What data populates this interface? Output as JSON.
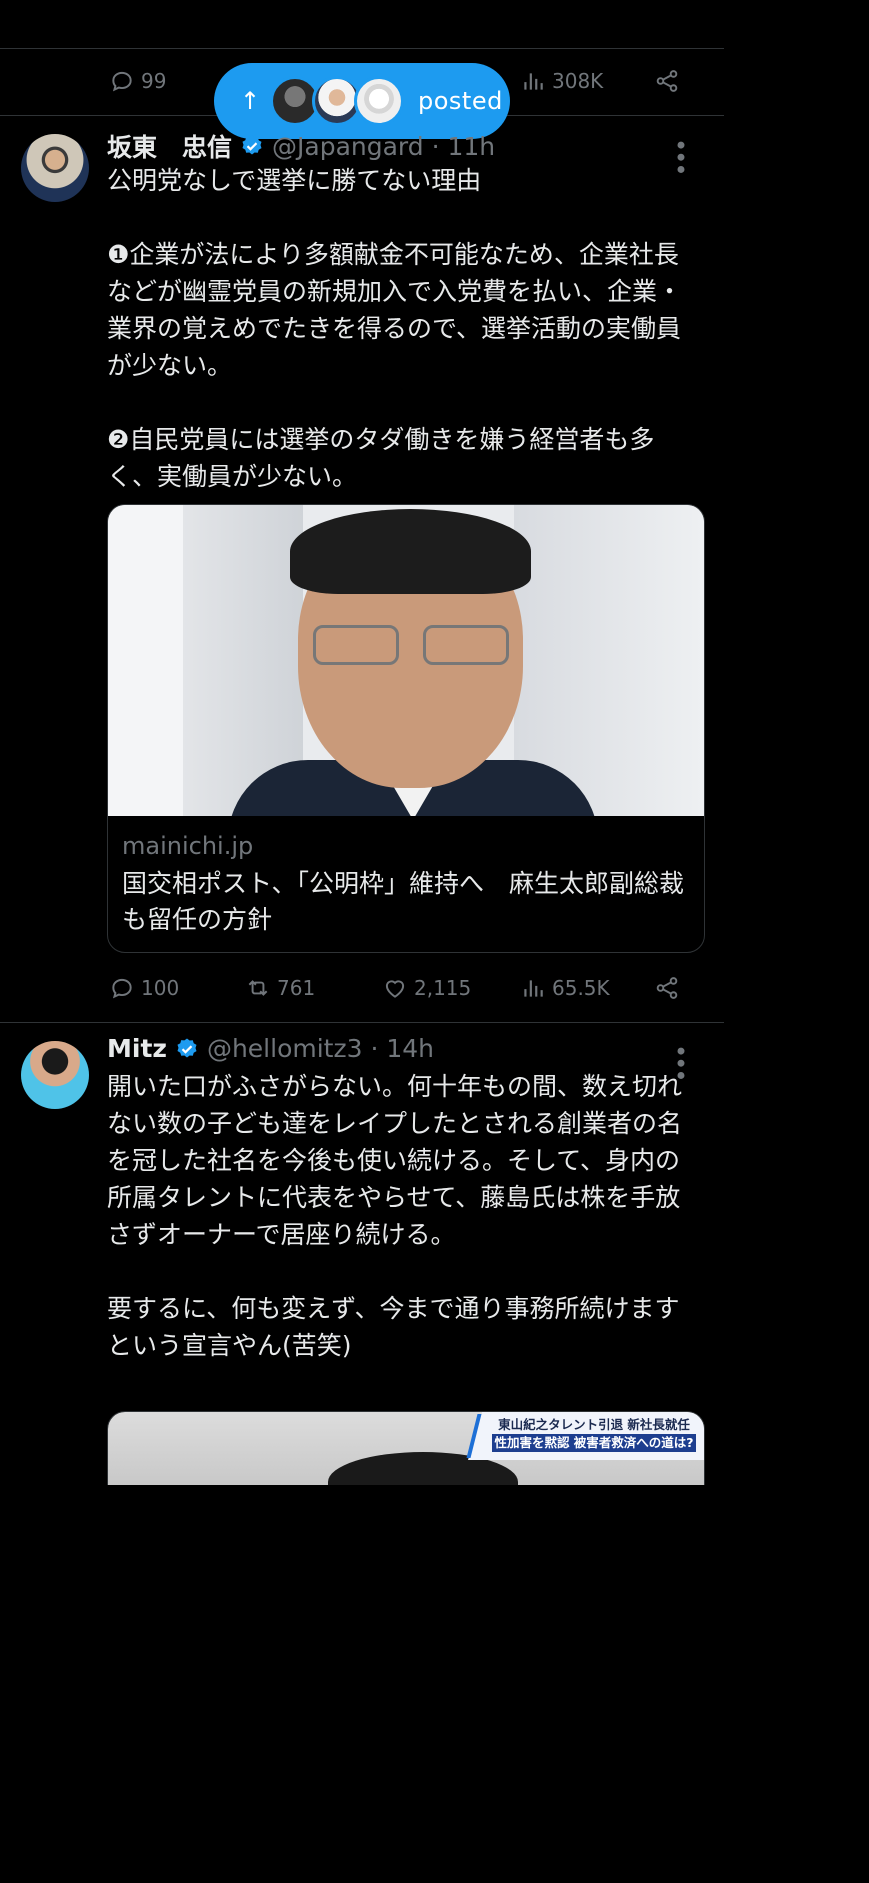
{
  "top_actions": {
    "replies": "99",
    "views": "308K"
  },
  "new_posts_pill": {
    "label": "posted"
  },
  "tweet1": {
    "name": "坂東　忠信",
    "handle": "@Japangard · 11h",
    "text": "公明党なしで選挙に勝てない理由\n\n❶企業が法により多額献金不可能なため、企業社長などが幽霊党員の新規加入で入党費を払い、企業・業界の覚えめでたきを得るので、選挙活動の実働員が少ない。\n\n❷自民党員には選挙のタダ働きを嫌う経営者も多く、実働員が少ない。",
    "card": {
      "domain": "mainichi.jp",
      "title": "国交相ポスト、「公明枠」維持へ　麻生太郎副総裁も留任の方針"
    },
    "actions": {
      "replies": "100",
      "reposts": "761",
      "likes": "2,115",
      "views": "65.5K"
    }
  },
  "tweet2": {
    "name": "Mitz",
    "handle": "@hellomitz3 · 14h",
    "text": "開いた口がふさがらない。何十年もの間、数え切れない数の子ども達をレイプしたとされる創業者の名を冠した社名を今後も使い続ける。そして、身内の所属タレントに代表をやらせて、藤島氏は株を手放さずオーナーで居座り続ける。\n\n要するに、何も変えず、今まで通り事務所続けますという宣言やん(苦笑)",
    "media_caption_1": "東山紀之タレント引退 新社長就任",
    "media_caption_2": "性加害を黙認 被害者救済への道は?"
  },
  "colors": {
    "accent": "#1d9bf0",
    "muted": "#71767b",
    "text": "#e7e9ea",
    "divider": "#2f3336"
  }
}
